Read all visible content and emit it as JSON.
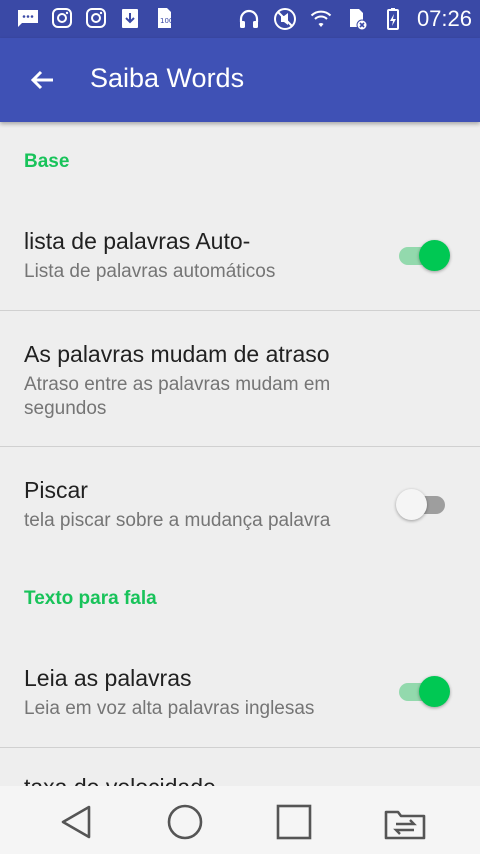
{
  "status_bar": {
    "time": "07:26",
    "left_icons": [
      "message-icon",
      "instagram-icon",
      "instagram-icon",
      "download-icon",
      "sd-card-icon"
    ],
    "right_icons": [
      "headphones-icon",
      "mute-icon",
      "wifi-icon",
      "no-sim-icon",
      "battery-charging-icon"
    ]
  },
  "app_bar": {
    "title": "Saiba Words",
    "back_icon": "arrow-back-icon",
    "color": "#3f51b5"
  },
  "settings": {
    "category_base": "Base",
    "auto_list": {
      "title": "lista de palavras Auto-",
      "summary": "Lista de palavras automáticos",
      "enabled": true
    },
    "delay": {
      "title": "As palavras mudam de atraso",
      "summary": "Atraso entre as palavras mudam em segundos"
    },
    "blink": {
      "title": "Piscar",
      "summary": "tela piscar sobre a mudança palavra",
      "enabled": false
    },
    "category_tts": "Texto para fala",
    "read_words": {
      "title": "Leia as palavras",
      "summary": "Leia em voz alta palavras inglesas",
      "enabled": true
    },
    "speed_rate": {
      "title": "taxa de velocidade"
    }
  },
  "colors": {
    "accent": "#00c853",
    "category_text": "#18c35a"
  },
  "nav_bar": {
    "icons": [
      "back-triangle-icon",
      "home-circle-icon",
      "recents-square-icon",
      "switch-app-icon"
    ]
  }
}
